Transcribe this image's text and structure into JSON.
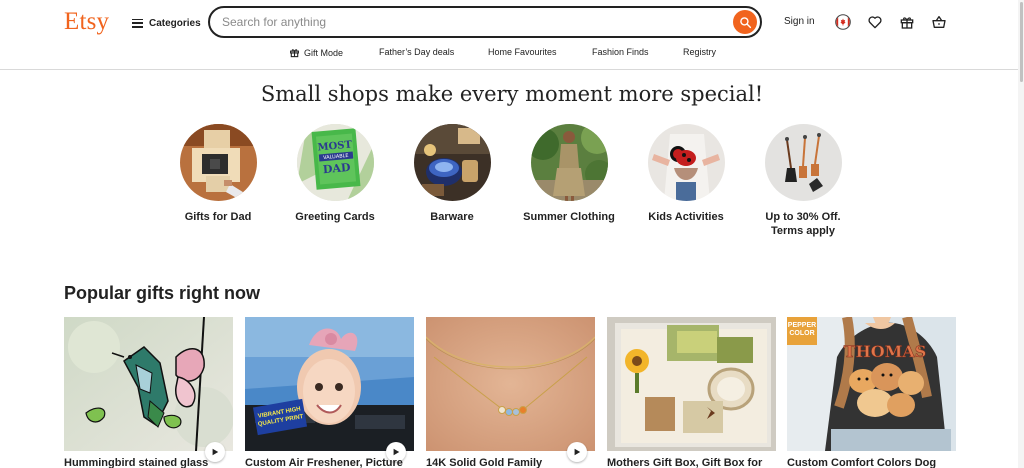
{
  "header": {
    "logo": "Etsy",
    "categories_label": "Categories",
    "search": {
      "placeholder": "Search for anything",
      "value": ""
    },
    "signin_label": "Sign in"
  },
  "subnav": {
    "items": [
      "Gift Mode",
      "Father’s Day deals",
      "Home Favourites",
      "Fashion Finds",
      "Registry"
    ]
  },
  "hero": {
    "title": "Small shops make every moment more special!",
    "circles": [
      {
        "label": "Gifts for Dad"
      },
      {
        "label": "Greeting Cards"
      },
      {
        "label": "Barware"
      },
      {
        "label": "Summer Clothing"
      },
      {
        "label": "Kids Activities"
      },
      {
        "label": "Up to 30% Off. Terms apply"
      }
    ],
    "card_art": {
      "lines": [
        "MOST",
        "VALUABLE",
        "DAD"
      ]
    }
  },
  "popular": {
    "title": "Popular gifts right now",
    "products": [
      {
        "title": "Hummingbird stained glass",
        "has_video": true
      },
      {
        "title": "Custom Air Freshener, Picture",
        "has_video": true,
        "badge": "VIBRANT HIGH QUALITY PRINT"
      },
      {
        "title": "14K Solid Gold Family",
        "has_video": true
      },
      {
        "title": "Mothers Gift Box, Gift Box for",
        "has_video": false
      },
      {
        "title": "Custom Comfort Colors Dog",
        "has_video": false,
        "badge": "PEPPER COLOR",
        "shirt_text": "THOMAS"
      }
    ]
  },
  "colors": {
    "brand_orange": "#f1641e",
    "text": "#222222",
    "border": "#d9d9d9"
  }
}
